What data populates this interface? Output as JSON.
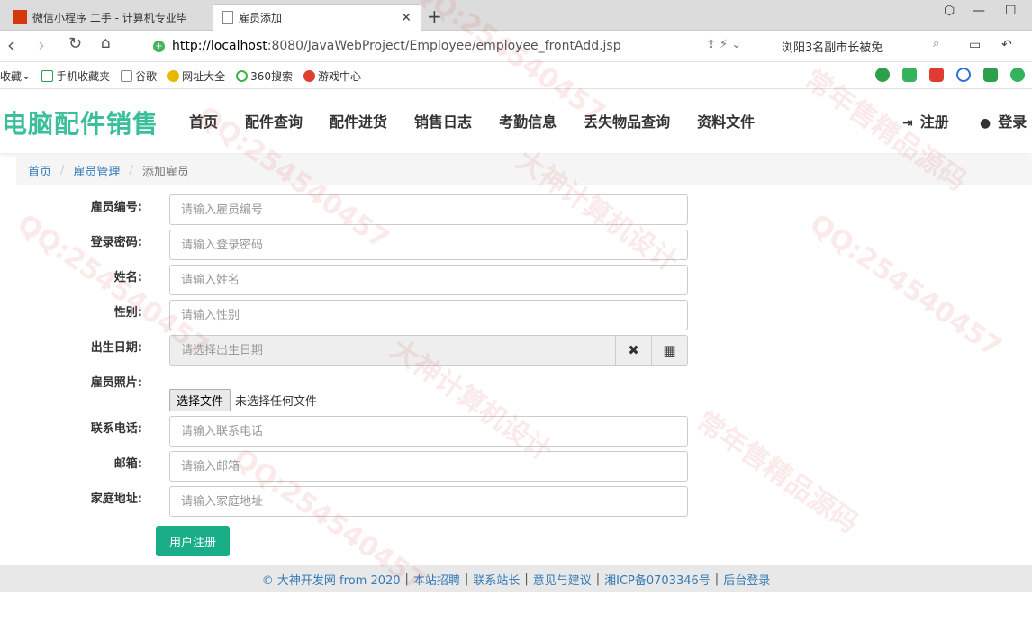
{
  "browser": {
    "tabs": [
      {
        "title": "微信小程序 二手 - 计算机专业毕",
        "active": false
      },
      {
        "title": "雇员添加",
        "active": true
      }
    ],
    "url_host": "http://localhost",
    "url_rest": ":8080/JavaWebProject/Employee/employee_frontAdd.jsp",
    "search_text": "浏阳3名副市长被免",
    "bookmarks": [
      "收藏",
      "手机收藏夹",
      "谷歌",
      "网址大全",
      "360搜索",
      "游戏中心"
    ]
  },
  "site": {
    "brand": "电脑配件销售",
    "nav": [
      "首页",
      "配件查询",
      "配件进货",
      "销售日志",
      "考勤信息",
      "丢失物品查询",
      "资料文件"
    ],
    "register": "注册",
    "login": "登录"
  },
  "breadcrumb": {
    "home": "首页",
    "section": "雇员管理",
    "current": "添加雇员"
  },
  "form": {
    "employee_no": {
      "label": "雇员编号:",
      "placeholder": "请输入雇员编号"
    },
    "password": {
      "label": "登录密码:",
      "placeholder": "请输入登录密码"
    },
    "name": {
      "label": "姓名:",
      "placeholder": "请输入姓名"
    },
    "gender": {
      "label": "性别:",
      "placeholder": "请输入性别"
    },
    "birthday": {
      "label": "出生日期:",
      "placeholder": "请选择出生日期"
    },
    "photo": {
      "label": "雇员照片:",
      "button": "选择文件",
      "status": "未选择任何文件"
    },
    "phone": {
      "label": "联系电话:",
      "placeholder": "请输入联系电话"
    },
    "email": {
      "label": "邮箱:",
      "placeholder": "请输入邮箱"
    },
    "address": {
      "label": "家庭地址:",
      "placeholder": "请输入家庭地址"
    },
    "submit": "用户注册"
  },
  "footer": {
    "links": [
      "© 大神开发网 from 2020",
      "本站招聘",
      "联系站长",
      "意见与建议",
      "湘ICP备0703346号",
      "后台登录"
    ]
  },
  "watermarks": [
    "QQ:254540457",
    "大神计算机设计",
    "常年售精品源码"
  ],
  "colors": {
    "brand": "#3bbf9b",
    "primary": "#1aae88",
    "link": "#337ab7"
  }
}
